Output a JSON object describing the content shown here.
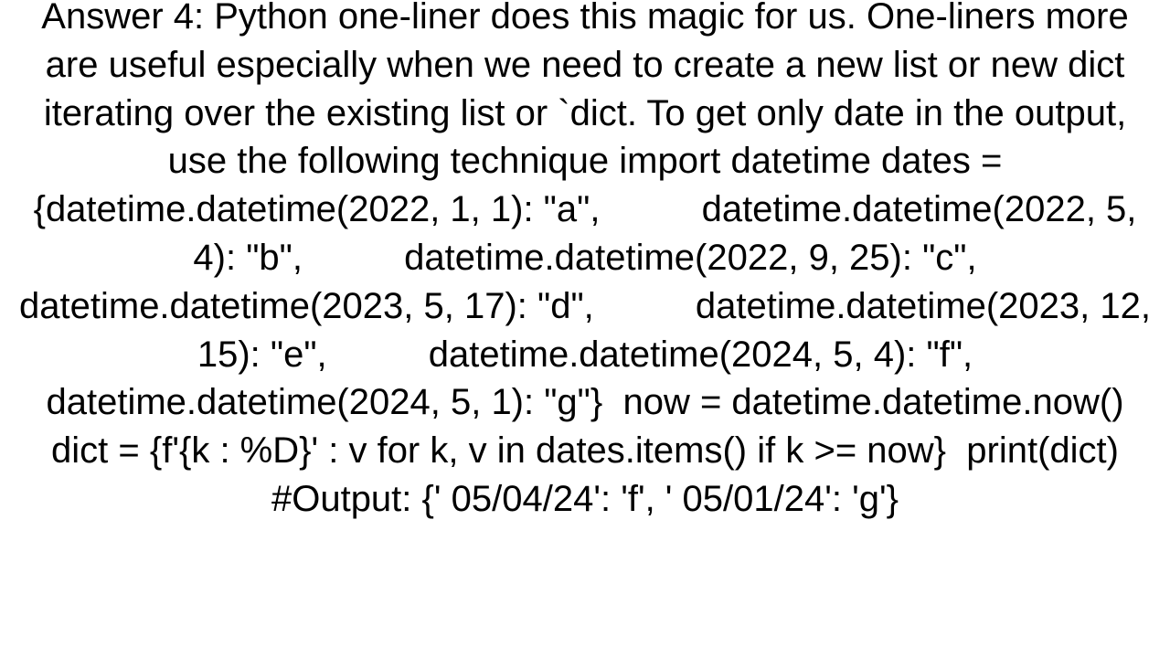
{
  "answer": {
    "text": "Answer 4: Python one-liner does this magic for us. One-liners more are useful especially when we need to create a new list or new dict iterating over the existing list or `dict. To get only date in the output, use the following technique import datetime dates = {datetime.datetime(2022, 1, 1): \"a\",          datetime.datetime(2022, 5, 4): \"b\",          datetime.datetime(2022, 9, 25): \"c\",          datetime.datetime(2023, 5, 17): \"d\",          datetime.datetime(2023, 12, 15): \"e\",          datetime.datetime(2024, 5, 4): \"f\",          datetime.datetime(2024, 5, 1): \"g\"}  now = datetime.datetime.now()  dict = {f'{k : %D}' : v for k, v in dates.items() if k >= now}  print(dict)  #Output: {' 05/04/24': 'f', ' 05/01/24': 'g'}"
  }
}
